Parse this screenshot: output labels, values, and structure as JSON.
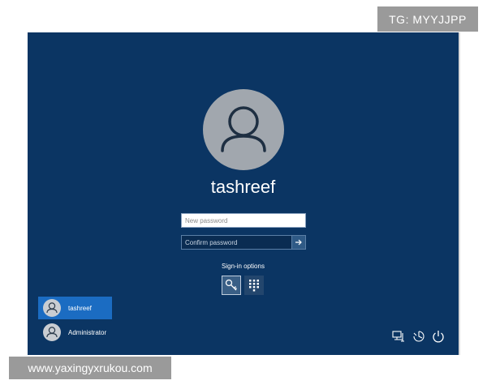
{
  "watermarks": {
    "top": "TG: MYYJJPP",
    "bottom": "www.yaxingyxrukou.com"
  },
  "login": {
    "username": "tashreef",
    "new_password_placeholder": "New password",
    "confirm_password_placeholder": "Confirm password",
    "submit_icon": "arrow-right-icon",
    "signin_options_label": "Sign-in options",
    "signin_options": [
      {
        "icon": "key-icon",
        "selected": true
      },
      {
        "icon": "pin-keypad-icon",
        "selected": false
      }
    ]
  },
  "user_list": [
    {
      "name": "tashreef",
      "selected": true
    },
    {
      "name": "Administrator",
      "selected": false
    }
  ],
  "tray": [
    {
      "icon": "network-icon"
    },
    {
      "icon": "ease-of-access-icon"
    },
    {
      "icon": "power-icon"
    }
  ],
  "colors": {
    "background": "#0b3563",
    "selected_user": "#1b6cc2",
    "avatar": "#a1a7ae"
  }
}
